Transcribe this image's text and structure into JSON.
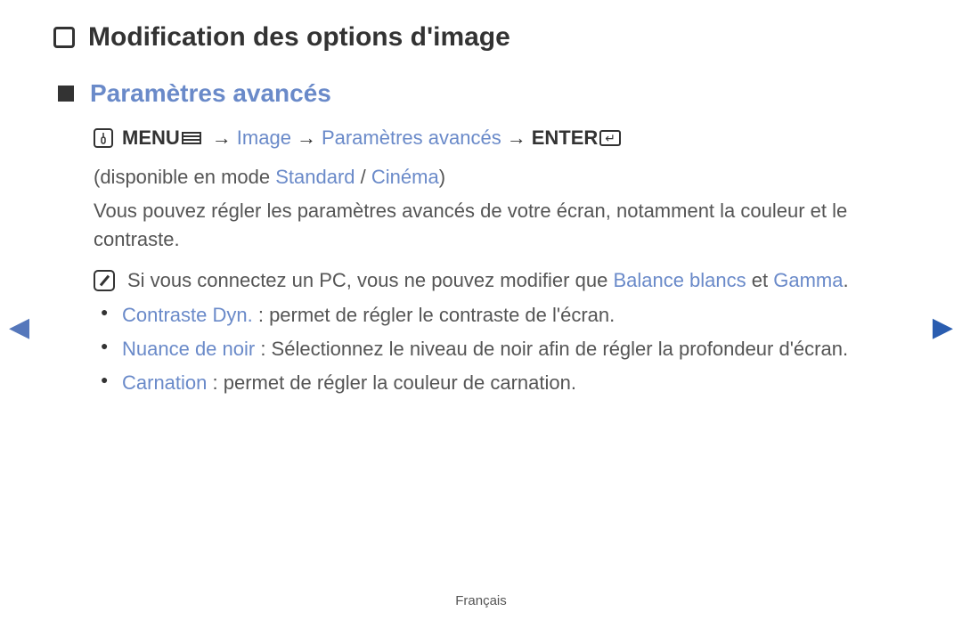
{
  "title": "Modification des options d'image",
  "section": "Paramètres avancés",
  "breadcrumb": {
    "menu": "MENU",
    "image": "Image",
    "params": "Paramètres avancés",
    "enter": "ENTER"
  },
  "availability": {
    "prefix": "(disponible en mode ",
    "mode1": "Standard",
    "sep": " / ",
    "mode2": "Cinéma",
    "suffix": ")"
  },
  "description": "Vous pouvez régler les paramètres avancés de votre écran, notamment la couleur et le contraste.",
  "note": {
    "prefix": "Si vous connectez un PC, vous ne pouvez modifier que ",
    "term1": "Balance blancs",
    "mid": " et ",
    "term2": "Gamma",
    "suffix": "."
  },
  "bullets": [
    {
      "label": "Contraste Dyn.",
      "text": " : permet de régler le contraste de l'écran."
    },
    {
      "label": "Nuance de noir",
      "text": " : Sélectionnez le niveau de noir afin de régler la profondeur d'écran."
    },
    {
      "label": "Carnation",
      "text": " : permet de régler la couleur de carnation."
    }
  ],
  "footer": "Français",
  "arrow": "→"
}
